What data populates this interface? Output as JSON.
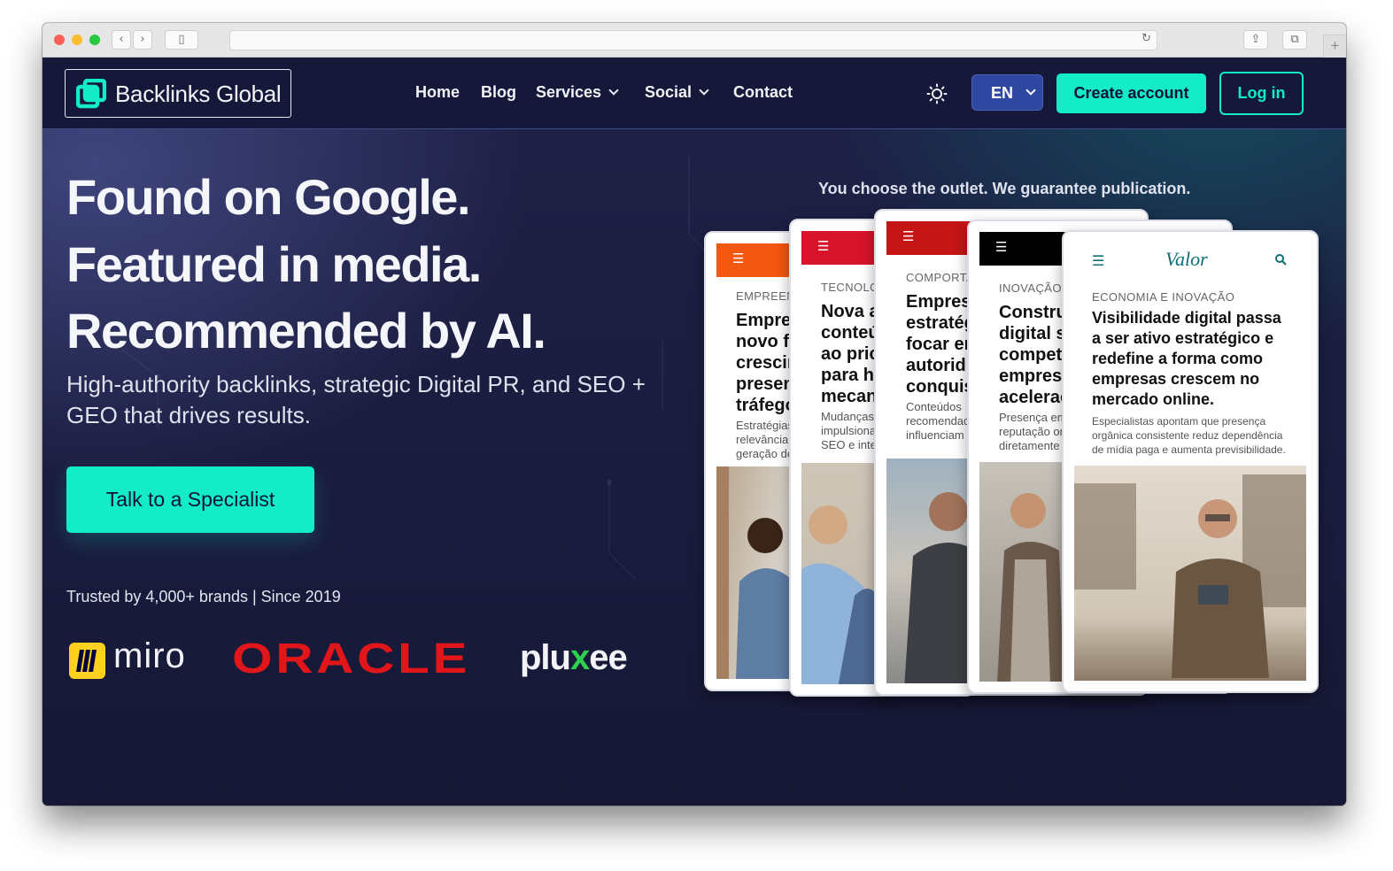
{
  "brand": {
    "name": "Backlinks Global",
    "accent": "#13ecc6",
    "navy": "#16183a"
  },
  "nav": {
    "home": "Home",
    "blog": "Blog",
    "services": "Services",
    "social": "Social",
    "contact": "Contact"
  },
  "header": {
    "theme_icon": "sun-icon",
    "language": "EN",
    "create_account": "Create account",
    "login": "Log in"
  },
  "hero": {
    "line1": "Found on Google.",
    "line2": "Featured in media.",
    "line3": "Recommended by AI.",
    "subtitle": "High-authority backlinks, strategic Digital PR, and SEO + GEO that drives results.",
    "cta": "Talk to a Specialist",
    "trust": "Trusted by 4,000+ brands | Since 2019"
  },
  "logos": {
    "miro": "miro",
    "oracle": "ORACLE",
    "pluxee_a": "plu",
    "pluxee_x": "x",
    "pluxee_b": "ee"
  },
  "showcase": {
    "caption": "You choose the outlet. We guarantee publication.",
    "cards": [
      {
        "category": "EMPREEN",
        "title": [
          "Empre",
          "novo f",
          "crescin",
          "presen",
          "tráfego"
        ],
        "desc": [
          "Estratégias",
          "relevância",
          "geração de"
        ],
        "bar_color": "#f4570f"
      },
      {
        "category": "TECNOLO",
        "title": [
          "Nova a",
          "conteú",
          "ao pric",
          "para h",
          "mecan"
        ],
        "desc": [
          "Mudanças",
          "impulsiona",
          "SEO e inte"
        ],
        "bar_color": "#d8142c"
      },
      {
        "category": "COMPORTA",
        "title": [
          "Empres",
          "estratég",
          "focar er",
          "autorid",
          "conquis"
        ],
        "desc": [
          "Conteúdos",
          "recomendad",
          "influenciam"
        ],
        "bar_color": "#c51515"
      },
      {
        "category": "INOVAÇÃO E",
        "title": [
          "Constru",
          "digital s",
          "competi",
          "empresa",
          "acelerac"
        ],
        "desc": [
          "Presença em",
          "reputação or",
          "diretamente"
        ],
        "bar_color": "#000000"
      },
      {
        "category": "ECONOMIA E INOVAÇÃO",
        "title": [
          "Visibilidade digital passa",
          "a ser ativo estratégico e",
          "redefine a forma como",
          "empresas crescem no",
          "mercado online."
        ],
        "desc": [
          "Especialistas apontam que presença",
          "orgânica consistente reduz dependência",
          "de mídia paga e aumenta previsibilidade."
        ],
        "masthead": "Valor",
        "masthead_color": "#0f6f78"
      }
    ]
  }
}
